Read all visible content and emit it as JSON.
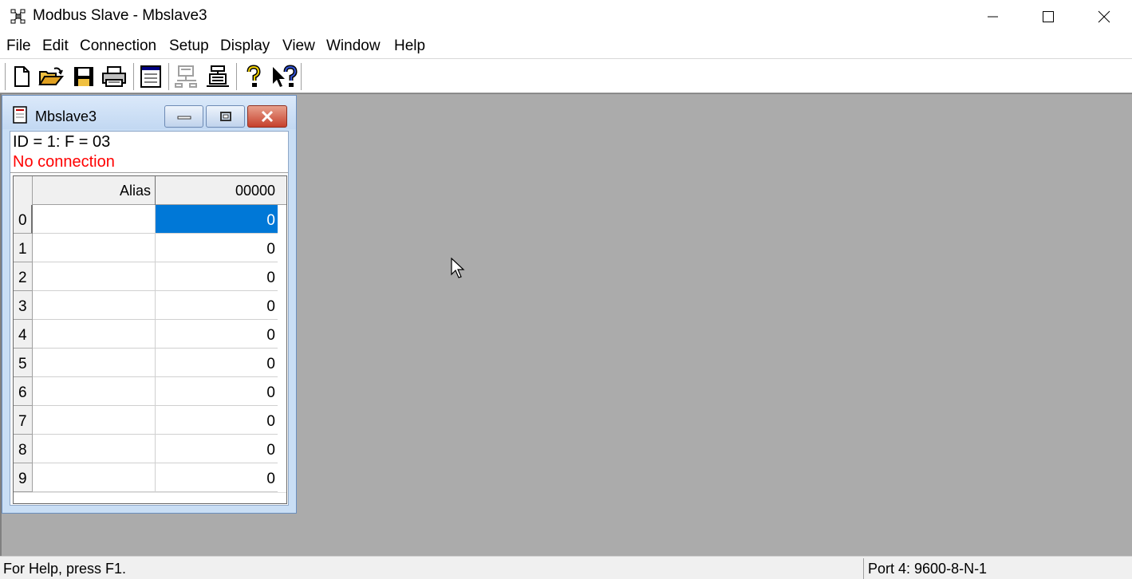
{
  "app": {
    "title": "Modbus Slave - Mbslave3",
    "icon": "network-nodes-icon"
  },
  "menu": [
    "File",
    "Edit",
    "Connection",
    "Setup",
    "Display",
    "View",
    "Window",
    "Help"
  ],
  "toolbar": {
    "buttons": [
      "new-document-icon",
      "open-folder-icon",
      "save-disk-icon",
      "print-icon",
      "slave-window-icon",
      "connect-network-icon",
      "disconnect-icon",
      "help-icon",
      "context-help-icon"
    ]
  },
  "child": {
    "title": "Mbslave3",
    "id_line": "ID = 1: F = 03",
    "status": "No connection",
    "columns": [
      "Alias",
      "00000"
    ],
    "rows": [
      {
        "num": "0",
        "alias": "",
        "value": "0"
      },
      {
        "num": "1",
        "alias": "",
        "value": "0"
      },
      {
        "num": "2",
        "alias": "",
        "value": "0"
      },
      {
        "num": "3",
        "alias": "",
        "value": "0"
      },
      {
        "num": "4",
        "alias": "",
        "value": "0"
      },
      {
        "num": "5",
        "alias": "",
        "value": "0"
      },
      {
        "num": "6",
        "alias": "",
        "value": "0"
      },
      {
        "num": "7",
        "alias": "",
        "value": "0"
      },
      {
        "num": "8",
        "alias": "",
        "value": "0"
      },
      {
        "num": "9",
        "alias": "",
        "value": "0"
      }
    ],
    "selected_row": 0
  },
  "status": {
    "help": "For Help, press F1.",
    "port": "Port 4: 9600-8-N-1"
  },
  "colors": {
    "mdi_background": "#ababab",
    "selection": "#0078d7",
    "status_text": "#ff0000"
  }
}
